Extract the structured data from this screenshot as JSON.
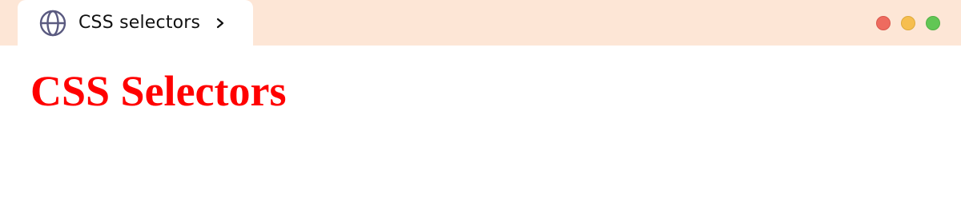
{
  "browser": {
    "tab": {
      "title": "CSS selectors",
      "icon": "globe-icon",
      "chevron_icon": "chevron-right-icon"
    },
    "window_controls": {
      "close_color": "#ee6b5f",
      "minimize_color": "#f6be4f",
      "maximize_color": "#62c655"
    },
    "titlebar_color": "#fde6d6"
  },
  "page": {
    "heading": "CSS Selectors",
    "heading_color": "#ff0000"
  }
}
